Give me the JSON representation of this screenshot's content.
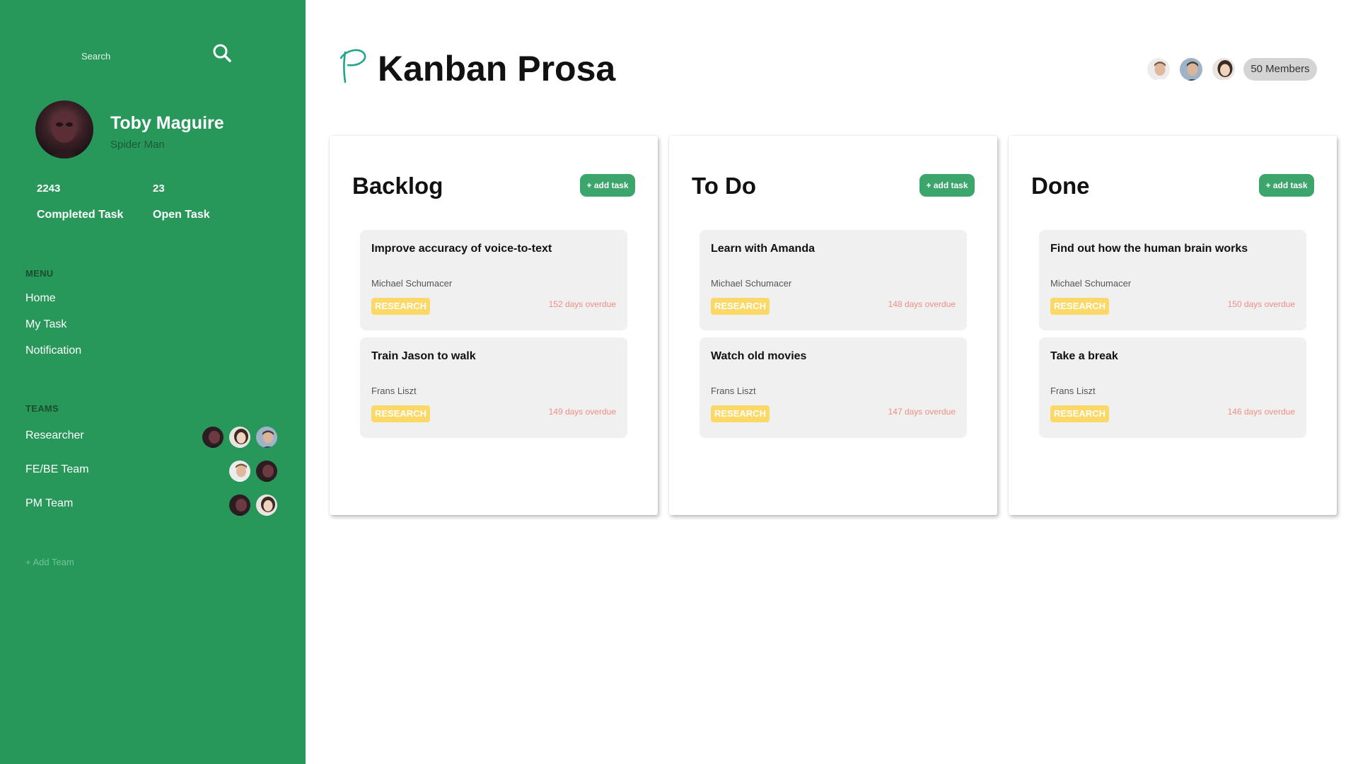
{
  "sidebar": {
    "search": {
      "placeholder": "Search"
    },
    "profile": {
      "name": "Toby Maguire",
      "role": "Spider Man"
    },
    "stats": [
      {
        "value": "2243",
        "label": "Completed Task"
      },
      {
        "value": "23",
        "label": "Open Task"
      }
    ],
    "menu": {
      "title": "MENU",
      "items": [
        {
          "label": "Home"
        },
        {
          "label": "My Task"
        },
        {
          "label": "Notification"
        }
      ]
    },
    "teams": {
      "title": "TEAMS",
      "items": [
        {
          "label": "Researcher",
          "member_count": 3
        },
        {
          "label": "FE/BE Team",
          "member_count": 2
        },
        {
          "label": "PM Team",
          "member_count": 2
        }
      ],
      "add_label": "+ Add Team"
    }
  },
  "header": {
    "title": "Kanban Prosa",
    "members_label": "50 Members"
  },
  "board": {
    "columns": [
      {
        "title": "Backlog",
        "add_label": "+ add task",
        "cards": [
          {
            "title": "Improve accuracy of voice-to-text",
            "assignee": "Michael Schumacer",
            "tag": "RESEARCH",
            "due": "152 days overdue"
          },
          {
            "title": "Train Jason to walk",
            "assignee": "Frans Liszt",
            "tag": "RESEARCH",
            "due": "149 days overdue"
          }
        ]
      },
      {
        "title": "To Do",
        "add_label": "+ add task",
        "cards": [
          {
            "title": "Learn with Amanda",
            "assignee": "Michael Schumacer",
            "tag": "RESEARCH",
            "due": "148 days overdue"
          },
          {
            "title": "Watch old movies",
            "assignee": "Frans Liszt",
            "tag": "RESEARCH",
            "due": "147 days overdue"
          }
        ]
      },
      {
        "title": "Done",
        "add_label": "+ add task",
        "cards": [
          {
            "title": "Find out how the human brain works",
            "assignee": "Michael Schumacer",
            "tag": "RESEARCH",
            "due": "150 days overdue"
          },
          {
            "title": "Take a break",
            "assignee": "Frans Liszt",
            "tag": "RESEARCH",
            "due": "146 days overdue"
          }
        ]
      }
    ]
  },
  "colors": {
    "sidebar_bg": "#27975a",
    "accent_button": "#3ba56c",
    "tag_bg": "#fcd867",
    "overdue_text": "#ee8f86",
    "card_bg": "#f0f0f0"
  },
  "icons": [
    "search-icon",
    "prosa-logo",
    "avatar"
  ]
}
